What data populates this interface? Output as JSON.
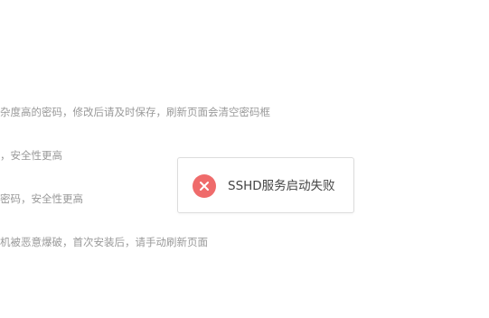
{
  "form_hints": [
    "杂度高的密码，修改后请及时保存，刷新页面会清空密码框",
    "，安全性更高",
    "密码，安全性更高",
    "机被恶意爆破，首次安装后，请手动刷新页面"
  ],
  "toast": {
    "icon": "error-close-icon",
    "icon_color": "#ef6b6b",
    "message": "SSHD服务启动失败"
  }
}
